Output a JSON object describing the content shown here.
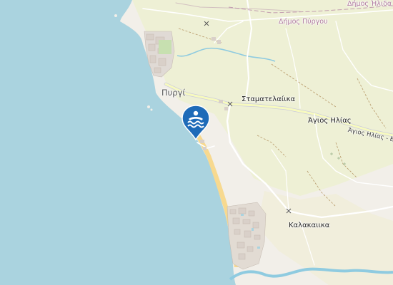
{
  "map": {
    "labels": {
      "municipality_top": "Δήμος Ήλιδα",
      "municipality_pyrgos": "Δήμος Πύργου",
      "town_pyrgi": "Πυργί",
      "village_stamatelaika": "Σταματελαίικα",
      "village_agios_ilias": "Άγιος Ηλίας",
      "road_agios_ilias": "Άγιος Ηλίας - Ε",
      "village_kalakaika": "Καλακαιικα"
    },
    "marker": {
      "type": "swimming-beach",
      "icon": "swimmer-waves-icon",
      "color": "#1e6bb8"
    },
    "colors": {
      "sea": "#aad3df",
      "land": "#f2efe9",
      "farmland": "#eef0d5",
      "beach": "#f7d98f",
      "river": "#8fcbe0",
      "boundary": "#b07aa0"
    }
  }
}
